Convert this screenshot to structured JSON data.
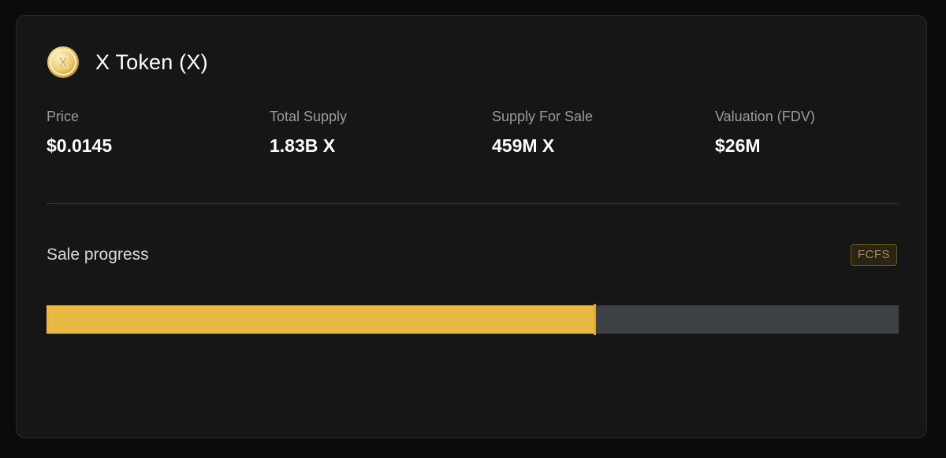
{
  "token": {
    "title": "X Token (X)",
    "logo_icon": "x-token-coin-icon",
    "logo_letter": "X",
    "logo_colors": [
      "#f6e6b4",
      "#e3b34a",
      "#b9862a"
    ]
  },
  "stats": [
    {
      "label": "Price",
      "value": "$0.0145"
    },
    {
      "label": "Total Supply",
      "value": "1.83B X"
    },
    {
      "label": "Supply For Sale",
      "value": "459M X"
    },
    {
      "label": "Valuation (FDV)",
      "value": "$26M"
    }
  ],
  "sale": {
    "label": "Sale progress",
    "badge": "FCFS",
    "progress_fraction": 0.643
  },
  "colors": {
    "accent": "#e8b944",
    "track": "#3d4045",
    "card_bg": "#161616",
    "page_bg": "#0b0b0b"
  }
}
